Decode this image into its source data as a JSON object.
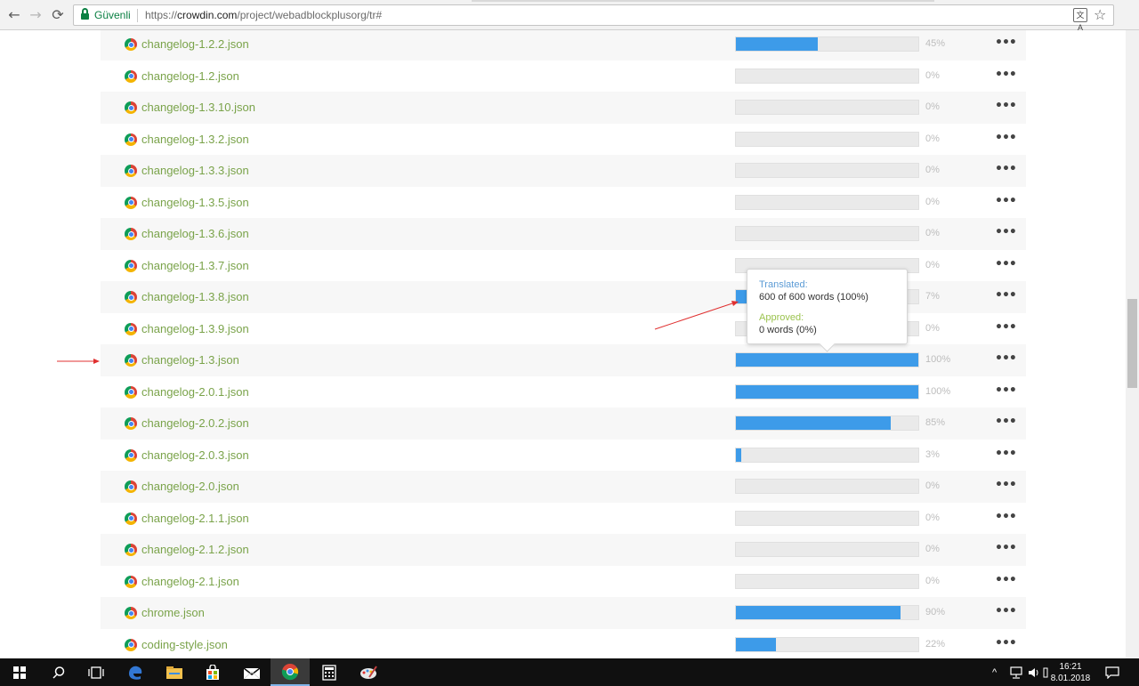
{
  "browser": {
    "back_glyph": "←",
    "forward_glyph": "→",
    "reload_glyph": "⟳",
    "secure_label": "Güvenli",
    "url_scheme": "https://",
    "url_host": "crowdin.com",
    "url_path": "/project/webadblockplusorg/tr#",
    "translate_glyph": "文A",
    "star_glyph": "☆"
  },
  "files": [
    {
      "name": "changelog-1.2.2.json",
      "percent": "45%",
      "progress": 45
    },
    {
      "name": "changelog-1.2.json",
      "percent": "0%",
      "progress": 0
    },
    {
      "name": "changelog-1.3.10.json",
      "percent": "0%",
      "progress": 0
    },
    {
      "name": "changelog-1.3.2.json",
      "percent": "0%",
      "progress": 0
    },
    {
      "name": "changelog-1.3.3.json",
      "percent": "0%",
      "progress": 0
    },
    {
      "name": "changelog-1.3.5.json",
      "percent": "0%",
      "progress": 0
    },
    {
      "name": "changelog-1.3.6.json",
      "percent": "0%",
      "progress": 0
    },
    {
      "name": "changelog-1.3.7.json",
      "percent": "0%",
      "progress": 0
    },
    {
      "name": "changelog-1.3.8.json",
      "percent": "7%",
      "progress": 7
    },
    {
      "name": "changelog-1.3.9.json",
      "percent": "0%",
      "progress": 0
    },
    {
      "name": "changelog-1.3.json",
      "percent": "100%",
      "progress": 100
    },
    {
      "name": "changelog-2.0.1.json",
      "percent": "100%",
      "progress": 100
    },
    {
      "name": "changelog-2.0.2.json",
      "percent": "85%",
      "progress": 85
    },
    {
      "name": "changelog-2.0.3.json",
      "percent": "3%",
      "progress": 3
    },
    {
      "name": "changelog-2.0.json",
      "percent": "0%",
      "progress": 0
    },
    {
      "name": "changelog-2.1.1.json",
      "percent": "0%",
      "progress": 0
    },
    {
      "name": "changelog-2.1.2.json",
      "percent": "0%",
      "progress": 0
    },
    {
      "name": "changelog-2.1.json",
      "percent": "0%",
      "progress": 0
    },
    {
      "name": "chrome.json",
      "percent": "90%",
      "progress": 90
    },
    {
      "name": "coding-style.json",
      "percent": "22%",
      "progress": 22
    }
  ],
  "row_menu_glyph": "•••",
  "tooltip": {
    "translated_label": "Translated:",
    "translated_value": "600 of 600 words (100%)",
    "approved_label": "Approved:",
    "approved_value": "0 words (0%)"
  },
  "colors": {
    "file_link": "#7aa34a",
    "progress_fill": "#3d9be9",
    "translated_label": "#5b9bd5",
    "approved_label": "#9bc34e",
    "annotation_arrow": "#e03030"
  },
  "taskbar": {
    "items": [
      "windows-start",
      "search",
      "task-view",
      "edge",
      "file-explorer",
      "store",
      "mail",
      "chrome",
      "calculator",
      "paint"
    ],
    "tray_up_glyph": "^",
    "clock_time": "16:21",
    "clock_date": "8.01.2018"
  }
}
